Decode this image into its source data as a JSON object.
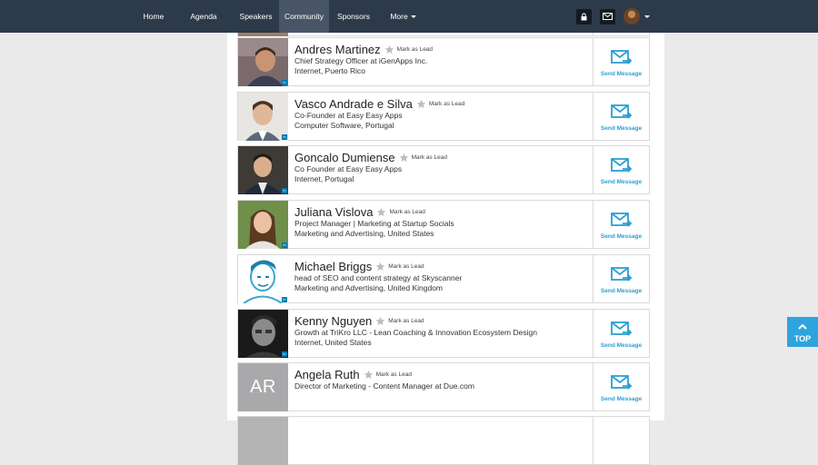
{
  "nav": {
    "items": [
      {
        "label": "Home",
        "width": 46,
        "active": false
      },
      {
        "label": "Agenda",
        "width": 64,
        "active": false
      },
      {
        "label": "Speakers",
        "width": 51,
        "active": false
      },
      {
        "label": "Community",
        "width": 55,
        "active": true
      },
      {
        "label": "Sponsors",
        "width": 54,
        "active": false
      },
      {
        "label": "More",
        "width": 55,
        "active": false
      }
    ]
  },
  "common": {
    "mark_as_lead": "Mark as Lead",
    "send_message": "Send Message",
    "top": "TOP"
  },
  "attendees": [
    {
      "name": "Andres Martinez",
      "title": "Chief Strategy Officer at iGenApps Inc.",
      "location": "Internet, Puerto Rico"
    },
    {
      "name": "Vasco Andrade e Silva",
      "title": "Co-Founder at Easy Easy Apps",
      "location": "Computer Software, Portugal"
    },
    {
      "name": "Goncalo Dumiense",
      "title": "Co Founder at Easy Easy Apps",
      "location": "Internet, Portugal"
    },
    {
      "name": "Juliana Vislova",
      "title": "Project Manager | Marketing at Startup Socials",
      "location": "Marketing and Advertising, United States"
    },
    {
      "name": "Michael Briggs",
      "title": "head of SEO and content strategy at Skyscanner",
      "location": "Marketing and Advertising, United Kingdom"
    },
    {
      "name": "Kenny Nguyen",
      "title": "Growth at TriKro LLC - Lean Coaching & Innovation Ecosystem Design",
      "location": "Internet, United States"
    },
    {
      "name": "Angela Ruth",
      "title": "Director of Marketing - Content Manager at Due.com",
      "location": "",
      "initials": "AR"
    }
  ],
  "colors": {
    "nav_bg": "#2d3a4a",
    "accent": "#2ea4dd",
    "link": "#2a9fd6"
  }
}
